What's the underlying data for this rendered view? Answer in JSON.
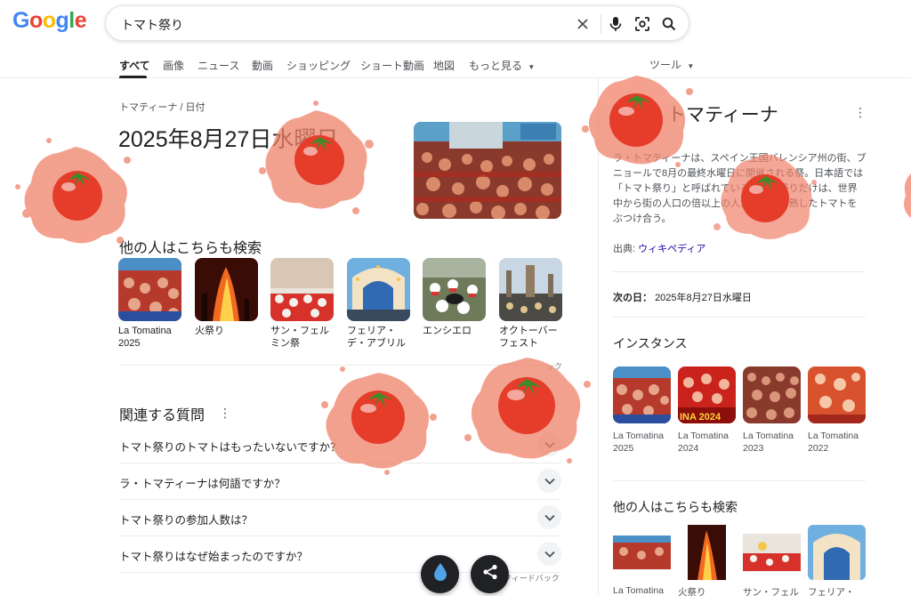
{
  "logo": {
    "letters": [
      "G",
      "o",
      "o",
      "g",
      "l",
      "e"
    ]
  },
  "search": {
    "query": "トマト祭り"
  },
  "tabs": [
    {
      "label": "すべて",
      "active": true
    },
    {
      "label": "画像"
    },
    {
      "label": "ニュース"
    },
    {
      "label": "動画"
    },
    {
      "label": "ショッピング"
    },
    {
      "label": "ショート動画"
    },
    {
      "label": "地図"
    },
    {
      "label": "もっと見る"
    }
  ],
  "tools_label": "ツール",
  "answer": {
    "breadcrumb": "トマティーナ / 日付",
    "date": "2025年8月27日水曜日"
  },
  "pasa": {
    "title": "他の人はこちらも検索",
    "items": [
      {
        "label": "La Tomatina 2025"
      },
      {
        "label": "火祭り"
      },
      {
        "label": "サン・フェルミン祭"
      },
      {
        "label": "フェリア・デ・アブリル"
      },
      {
        "label": "エンシエロ"
      },
      {
        "label": "オクトーバーフェスト"
      }
    ],
    "feedback_partial": "ック"
  },
  "paa": {
    "title": "関連する質問",
    "questions": [
      "トマト祭りのトマトはもったいないですか？",
      "ラ・トマティーナは何語ですか？",
      "トマト祭りの参加人数は？",
      "トマト祭りはなぜ始まったのですか？"
    ],
    "feedback_partial": "フィードバック"
  },
  "knowledge_panel": {
    "title": "トマティーナ",
    "description": "ラ・トマティーナは、スペイン王国バレンシア州の街、ブニョールで8月の最終水曜日に開催される祭。日本語では「トマト祭り」と呼ばれている。この祭りだけは、世界中から街の人口の倍以上の人が集まり、熟したトマトをぶつけ合う。",
    "source_prefix": "出典: ",
    "source_link": "ウィキペディア",
    "next_day_label": "次の日：",
    "next_day_value": "2025年8月27日水曜日",
    "instances_title": "インスタンス",
    "instances": [
      {
        "label": "La Tomatina 2025"
      },
      {
        "label": "La Tomatina 2024",
        "overlay": "INA 2024"
      },
      {
        "label": "La Tomatina 2023"
      },
      {
        "label": "La Tomatina 2022"
      }
    ],
    "also_search_title": "他の人はこちらも検索",
    "also_search": [
      {
        "label": "La Tomatina"
      },
      {
        "label": "火祭り"
      },
      {
        "label": "サン・フェル"
      },
      {
        "label": "フェリア・"
      }
    ]
  },
  "colors": {
    "tomato": "#e53d2a",
    "splat": "#f0826a",
    "link": "#1a0dab"
  }
}
